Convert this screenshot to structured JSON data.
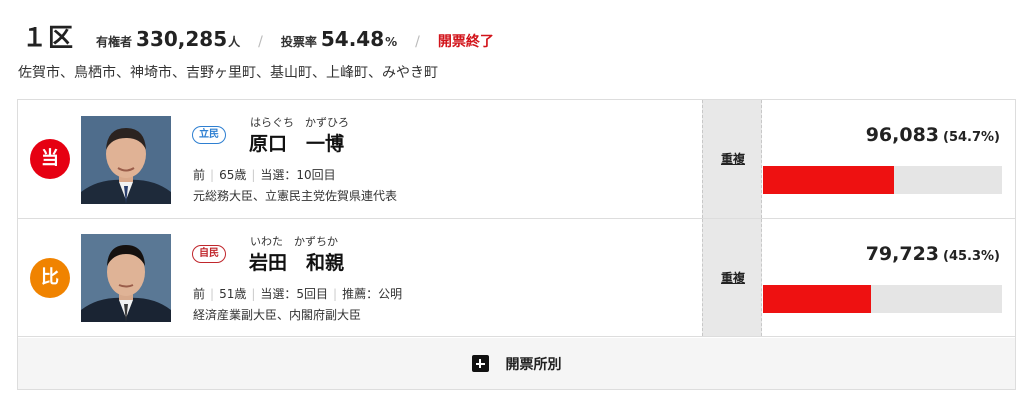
{
  "header": {
    "district": "１区",
    "voters_label": "有権者",
    "voters_value": "330,285",
    "voters_unit": "人",
    "turnout_label": "投票率",
    "turnout_value": "54.48",
    "turnout_unit": "%",
    "status": "開票終了"
  },
  "area": "佐賀市、鳥栖市、神埼市、吉野ヶ里町、基山町、上峰町、みやき町",
  "candidates": [
    {
      "result_badge": "当",
      "result_color": "#e60012",
      "photo_icon": "candidate-photo",
      "party": "立民",
      "party_color": "#2e7fd1",
      "kana": "はらぐち　かずひろ",
      "name": "原口　一博",
      "incumbency": "前",
      "age": "65歳",
      "elected": "当選：10回目",
      "recommendation": "",
      "career": "元総務大臣、立憲民主党佐賀県連代表",
      "duplicate": "重複",
      "votes": "96,083",
      "share": "(54.7%)",
      "share_value": 54.7
    },
    {
      "result_badge": "比",
      "result_color": "#f08300",
      "photo_icon": "candidate-photo",
      "party": "自民",
      "party_color": "#c0262c",
      "kana": "いわた　かずちか",
      "name": "岩田　和親",
      "incumbency": "前",
      "age": "51歳",
      "elected": "当選：5回目",
      "recommendation": "推薦：公明",
      "career": "経済産業副大臣、内閣府副大臣",
      "duplicate": "重複",
      "votes": "79,723",
      "share": "(45.3%)",
      "share_value": 45.3
    }
  ],
  "footer": {
    "icon": "plus-square-icon",
    "label": "開票所別"
  }
}
